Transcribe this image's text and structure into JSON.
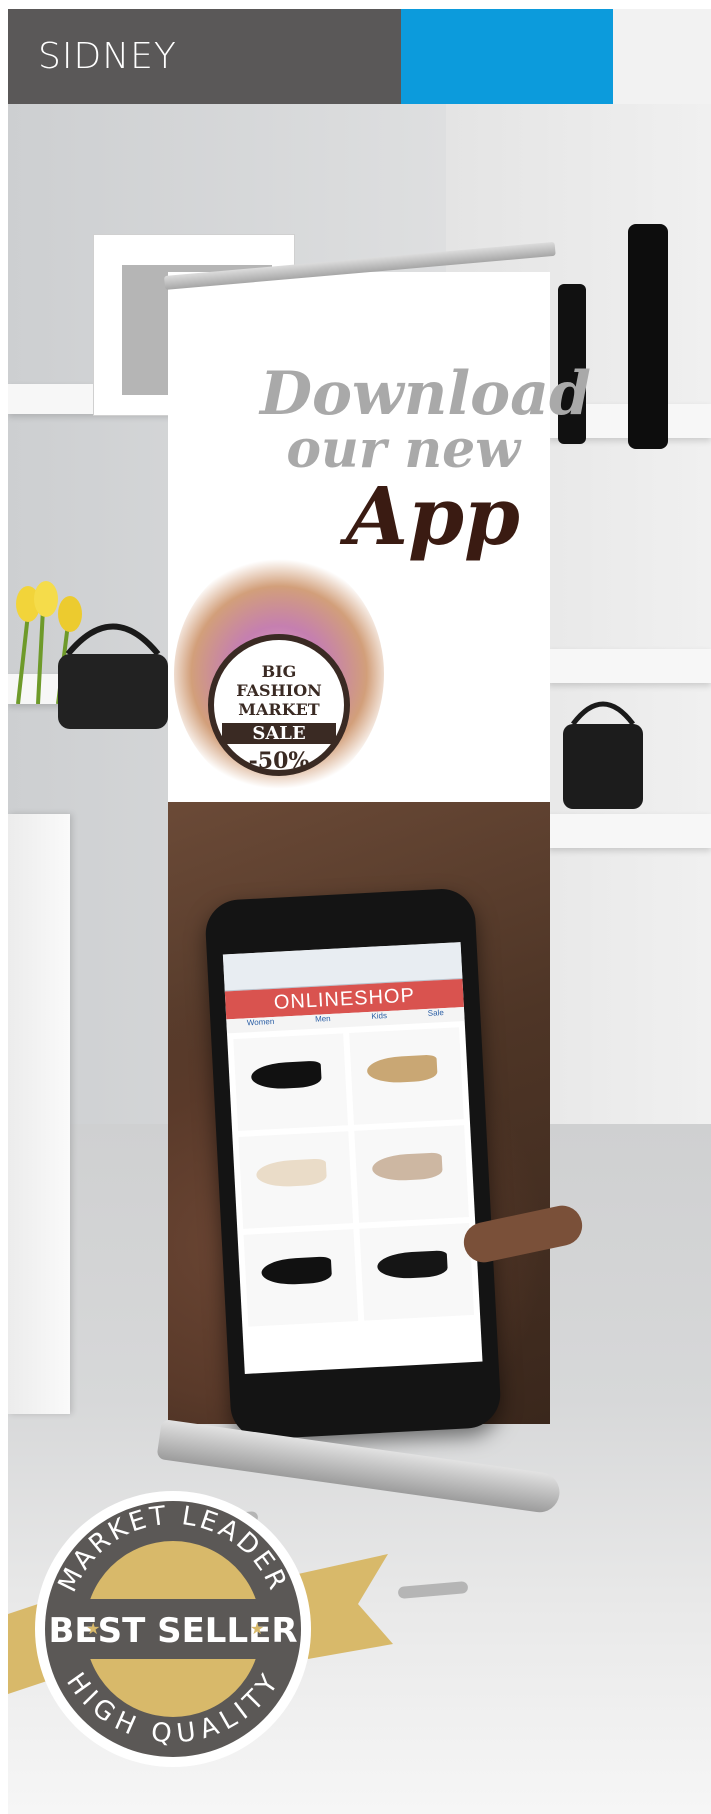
{
  "header": {
    "title": "SIDNEY"
  },
  "banner": {
    "headline_line1": "Download",
    "headline_line2": "our new",
    "headline_line3": "App",
    "sale_badge": {
      "line1": "BIG",
      "line2": "FASHION",
      "line3": "MARKET",
      "line4": "SALE",
      "line5": "-50%"
    },
    "phone_screen": {
      "shop_title": "ONLINESHOP",
      "nav": [
        "Women",
        "Men",
        "Kids",
        "Sale"
      ]
    }
  },
  "seal": {
    "top_text": "MARKET LEADER",
    "center_text": "BEST SELLER",
    "bottom_text": "HIGH QUALITY"
  },
  "colors": {
    "header_gray": "#5a5858",
    "header_blue": "#0c9bdc",
    "header_light": "#f2f2f2",
    "seal_gold": "#d8b96a",
    "seal_dark": "#5b5856"
  }
}
